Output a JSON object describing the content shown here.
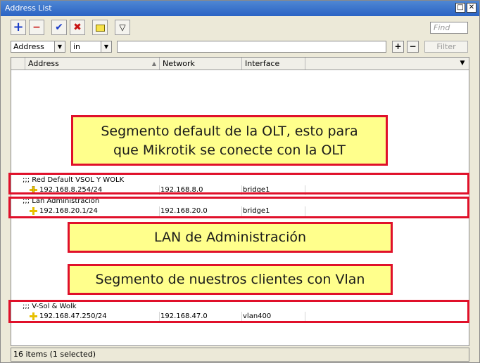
{
  "window": {
    "title": "Address List"
  },
  "toolbar": {
    "find_placeholder": "Find"
  },
  "filterbar": {
    "field_value": "Address",
    "operator_value": "in",
    "filter_label": "Filter"
  },
  "columns": {
    "address": "Address",
    "network": "Network",
    "interface": "Interface"
  },
  "entries": [
    {
      "comment": ";;; Red Default VSOL Y WOLK",
      "address": "192.168.8.254/24",
      "network": "192.168.8.0",
      "interface": "bridge1"
    },
    {
      "comment": ";;; Lan Administracion",
      "address": "192.168.20.1/24",
      "network": "192.168.20.0",
      "interface": "bridge1"
    },
    {
      "comment": ";;; V-Sol & Wolk",
      "address": "192.168.47.250/24",
      "network": "192.168.47.0",
      "interface": "vlan400"
    }
  ],
  "status": {
    "text": "16 items (1 selected)"
  },
  "annotations": {
    "note1_line1": "Segmento default de la OLT, esto para",
    "note1_line2": "que Mikrotik se conecte con la OLT",
    "note2": "LAN de Administración",
    "note3": "Segmento de nuestros clientes con Vlan"
  },
  "colors": {
    "accent_red": "#e0102a",
    "note_yellow": "#ffff8c",
    "add_blue": "#1a3cc8",
    "remove_red": "#c81414"
  }
}
